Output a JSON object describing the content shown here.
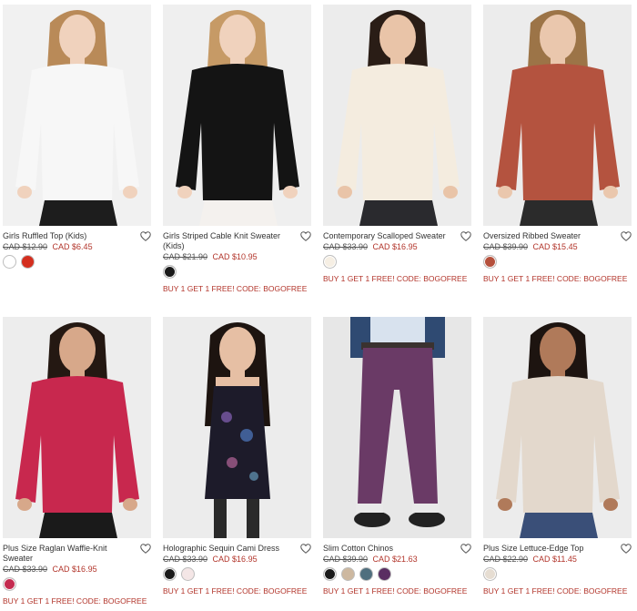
{
  "products": [
    {
      "title": "Girls Ruffled Top (Kids)",
      "old_price": "CAD $12.90",
      "new_price": "CAD $6.45",
      "swatches": [
        "#ffffff",
        "#d42e1e"
      ],
      "promo": "",
      "photo": {
        "bg": "#f1f1f1",
        "top": "#f7f7f7",
        "bottom": "#1d1d1d",
        "hair": "#b98a58",
        "skin": "#f0d2bd"
      }
    },
    {
      "title": "Girls Striped Cable Knit Sweater (Kids)",
      "old_price": "CAD $21.90",
      "new_price": "CAD $10.95",
      "swatches": [
        "#1a1a1a"
      ],
      "promo": "BUY 1 GET 1 FREE! CODE: BOGOFREE",
      "photo": {
        "bg": "#efefef",
        "top": "#141414",
        "bottom": "#f4f1ee",
        "hair": "#c69a66",
        "skin": "#f0d2bd"
      }
    },
    {
      "title": "Contemporary Scalloped Sweater",
      "old_price": "CAD $33.90",
      "new_price": "CAD $16.95",
      "swatches": [
        "#f6efe4"
      ],
      "promo": "BUY 1 GET 1 FREE! CODE: BOGOFREE",
      "photo": {
        "bg": "#ececec",
        "top": "#f4ecdf",
        "bottom": "#2a2a2e",
        "hair": "#2a1d16",
        "skin": "#e9c4a8"
      }
    },
    {
      "title": "Oversized Ribbed Sweater",
      "old_price": "CAD $39.90",
      "new_price": "CAD $15.45",
      "swatches": [
        "#b5503c"
      ],
      "promo": "BUY 1 GET 1 FREE! CODE: BOGOFREE",
      "photo": {
        "bg": "#ececec",
        "top": "#b4533f",
        "bottom": "#2b2b2b",
        "hair": "#9c7447",
        "skin": "#eac7ad"
      }
    },
    {
      "title": "Plus Size Raglan Waffle-Knit Sweater",
      "old_price": "CAD $33.90",
      "new_price": "CAD $16.95",
      "swatches": [
        "#c42a4f"
      ],
      "promo": "BUY 1 GET 1 FREE! CODE: BOGOFREE",
      "photo": {
        "bg": "#ededed",
        "top": "#c8284e",
        "bottom": "#1a1a1a",
        "hair": "#241812",
        "skin": "#d7a88a"
      }
    },
    {
      "title": "Holographic Sequin Cami Dress",
      "old_price": "CAD $33.90",
      "new_price": "CAD $16.95",
      "swatches": [
        "#1a1a1a",
        "#f4e6e6"
      ],
      "promo": "BUY 1 GET 1 FREE! CODE: BOGOFREE",
      "photo": {
        "bg": "#ececec",
        "top": "#1d1b2a",
        "bottom": "#1d1b2a",
        "hair": "#1d1410",
        "skin": "#e6bfa4"
      }
    },
    {
      "title": "Slim Cotton Chinos",
      "old_price": "CAD $39.90",
      "new_price": "CAD $21.63",
      "swatches": [
        "#1a1a1a",
        "#cdb8a0",
        "#4f6f7e",
        "#5a2e62"
      ],
      "promo": "BUY 1 GET 1 FREE! CODE: BOGOFREE",
      "photo": {
        "bg": "#e7e7e7",
        "top": "#2f4a72",
        "bottom": "#6a3a66",
        "hair": "#000000",
        "skin": "#e2bfa5"
      }
    },
    {
      "title": "Plus Size Lettuce-Edge Top",
      "old_price": "CAD $22.90",
      "new_price": "CAD $11.45",
      "swatches": [
        "#e6ddd2"
      ],
      "promo": "BUY 1 GET 1 FREE! CODE: BOGOFREE",
      "photo": {
        "bg": "#ececec",
        "top": "#e3d8cc",
        "bottom": "#3a4f78",
        "hair": "#1d1410",
        "skin": "#b07a5a"
      }
    }
  ]
}
